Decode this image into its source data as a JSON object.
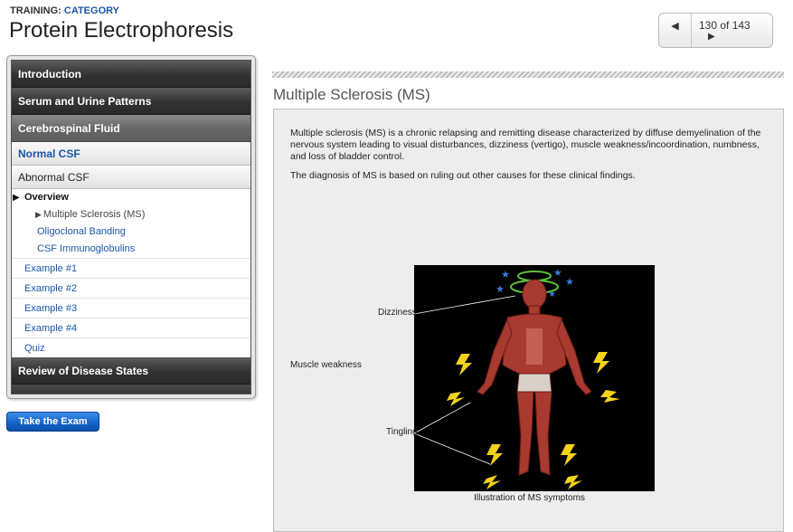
{
  "header": {
    "crumb_prefix": "TRAINING:",
    "crumb_category": "CATEGORY",
    "title": "Protein Electrophoresis"
  },
  "pager": {
    "prev_icon": "left-triangle-icon",
    "next_icon": "right-triangle-icon",
    "prev_glyph": "◀",
    "next_glyph": "▶",
    "count": "130 of 143"
  },
  "sidebar": {
    "introduction": "Introduction",
    "serum_urine": "Serum and Urine Patterns",
    "csf": "Cerebrospinal Fluid",
    "normal_csf": "Normal CSF",
    "abnormal_csf": "Abnormal CSF",
    "tree": {
      "overview": "Overview",
      "current": "Multiple Sclerosis (MS)",
      "oligoclonal": "Oligoclonal Banding",
      "immunoglobulins": "CSF Immunoglobulins"
    },
    "examples": [
      "Example #1",
      "Example #2",
      "Example #3",
      "Example #4"
    ],
    "quiz": "Quiz",
    "review": "Review of Disease States"
  },
  "exam_button": "Take the Exam",
  "main": {
    "section_title": "Multiple Sclerosis (MS)",
    "paragraph1": "Multiple sclerosis (MS) is a chronic relapsing and remitting disease characterized by diffuse demyelination of the nervous system leading to visual disturbances, dizziness (vertigo), muscle weakness/incoordination, numbness, and loss of bladder control.",
    "paragraph2": "The diagnosis of MS is based on ruling out other causes for these clinical findings.",
    "figure": {
      "label_dizziness": "Dizziness",
      "label_muscle": "Muscle weakness",
      "label_tingling": "Tingling",
      "caption": "Illustration of MS symptoms"
    }
  },
  "colors": {
    "link_blue": "#1a56a8",
    "nav_dark": "#333333",
    "button_blue": "#1262c9",
    "muscle_red": "#a83a30",
    "lightning_yellow": "#f2d21b",
    "star_blue": "#3a7ad8",
    "halo_green": "#5cc43a"
  }
}
